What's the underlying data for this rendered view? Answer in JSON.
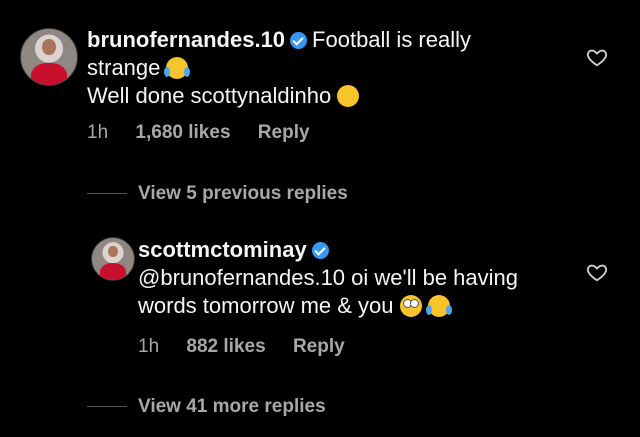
{
  "comment1": {
    "username": "brunofernandes.10",
    "text_line1": "Football is really",
    "text_line2": "strange",
    "text_line3": "Well done scottynaldinho",
    "time": "1h",
    "likes": "1,680 likes",
    "reply_label": "Reply"
  },
  "view_previous": "View 5 previous replies",
  "comment2": {
    "username": "scottmctominay",
    "text_line1": "@brunofernandes.10 oi we'll be having",
    "text_line2": "words tomorrow me & you",
    "time": "1h",
    "likes": "882 likes",
    "reply_label": "Reply"
  },
  "view_more": "View 41 more replies",
  "colors": {
    "verified": "#3897f0",
    "meta": "#a8a8a8"
  }
}
